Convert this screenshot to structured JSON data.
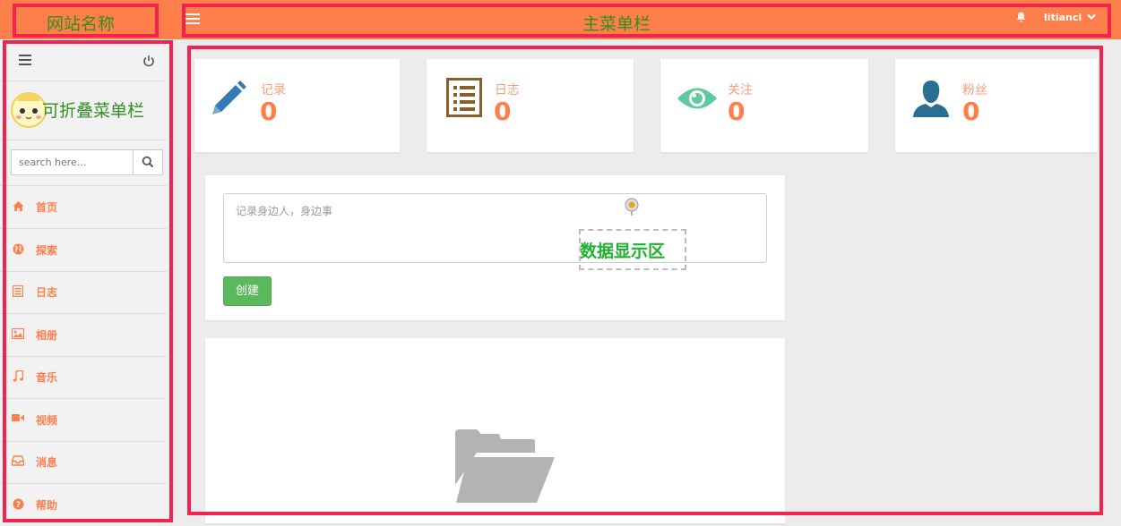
{
  "annotations": {
    "site_name": "网站名称",
    "main_menu": "主菜单栏",
    "collapsible_menu": "可折叠菜单栏",
    "data_area": "数据显示区"
  },
  "header": {
    "user_name": "litianci"
  },
  "sidebar": {
    "search_placeholder": "search here...",
    "items": [
      {
        "label": "首页",
        "icon": "home-icon"
      },
      {
        "label": "探索",
        "icon": "globe-icon"
      },
      {
        "label": "日志",
        "icon": "list-icon"
      },
      {
        "label": "相册",
        "icon": "image-icon"
      },
      {
        "label": "音乐",
        "icon": "music-icon"
      },
      {
        "label": "视频",
        "icon": "video-icon"
      },
      {
        "label": "消息",
        "icon": "inbox-icon"
      },
      {
        "label": "帮助",
        "icon": "help-icon"
      }
    ]
  },
  "stats": [
    {
      "label": "记录",
      "value": "0",
      "icon": "pencil-icon",
      "color": "#337ab7"
    },
    {
      "label": "日志",
      "value": "0",
      "icon": "list-icon",
      "color": "#8b5e2b"
    },
    {
      "label": "关注",
      "value": "0",
      "icon": "eye-icon",
      "color": "#5fc9a0"
    },
    {
      "label": "粉丝",
      "value": "0",
      "icon": "user-icon",
      "color": "#2a6f93"
    }
  ],
  "post": {
    "placeholder": "记录身边人，身边事",
    "create_label": "创建"
  },
  "colors": {
    "accent": "#ff7f4a",
    "annotation_border": "#f3234f",
    "success": "#5cb85c"
  }
}
